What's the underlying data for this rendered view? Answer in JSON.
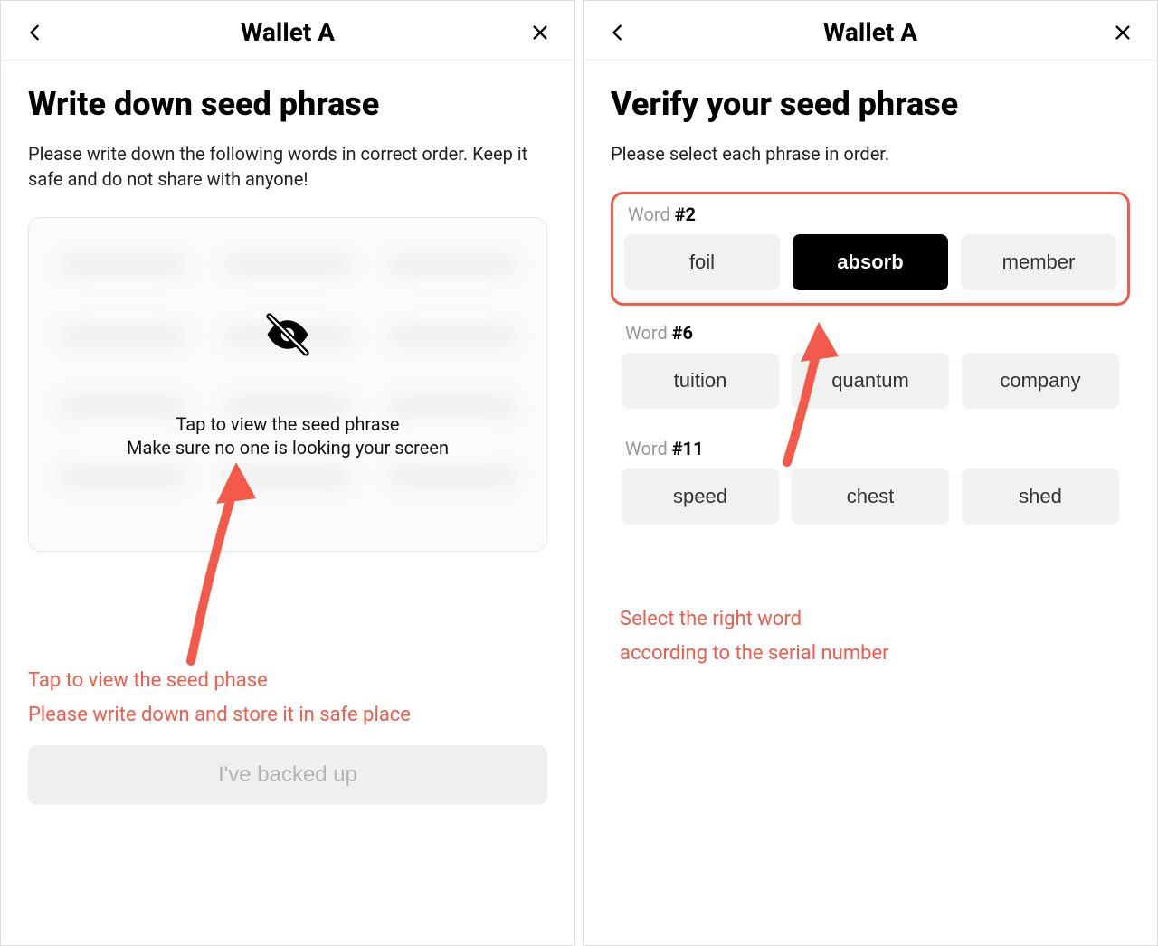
{
  "left": {
    "header": {
      "title": "Wallet A"
    },
    "title": "Write down seed phrase",
    "subtitle": "Please write down the following words in correct order. Keep it safe and do not share with anyone!",
    "overlay_line1": "Tap to view the seed phrase",
    "overlay_line2": "Make sure no one is looking your screen",
    "annotation_line1": "Tap to view the seed phase",
    "annotation_line2": "Please write down and store it in safe place",
    "backup_button": "I've backed up"
  },
  "right": {
    "header": {
      "title": "Wallet A"
    },
    "title": "Verify your seed phrase",
    "subtitle": "Please select each phrase in order.",
    "word_prefix": "Word",
    "blocks": [
      {
        "num": "#2",
        "options": [
          "foil",
          "absorb",
          "member"
        ],
        "selected": 1,
        "highlight": true
      },
      {
        "num": "#6",
        "options": [
          "tuition",
          "quantum",
          "company"
        ],
        "selected": -1,
        "highlight": false
      },
      {
        "num": "#11",
        "options": [
          "speed",
          "chest",
          "shed"
        ],
        "selected": -1,
        "highlight": false
      }
    ],
    "annotation_line1": "Select the right word",
    "annotation_line2": "according to the serial number"
  },
  "colors": {
    "accent": "#f45a4a"
  }
}
